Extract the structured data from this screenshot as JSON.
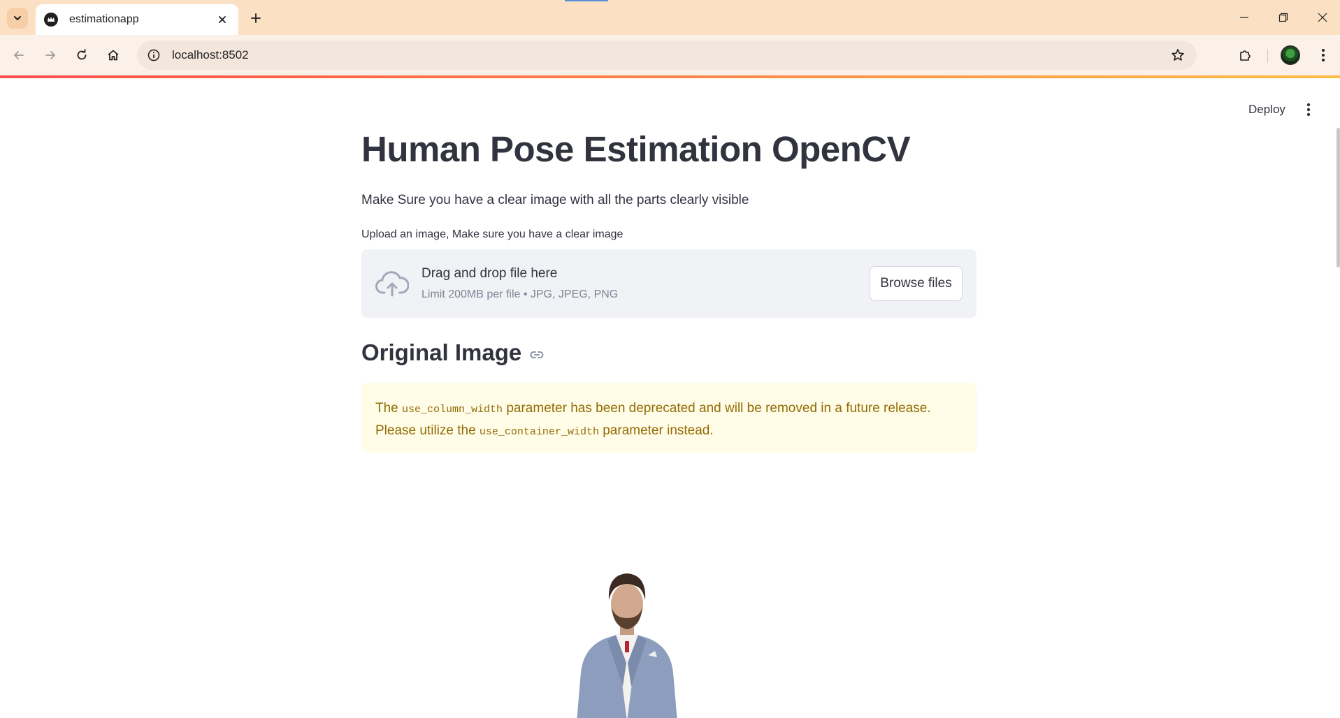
{
  "browser": {
    "tab_title": "estimationapp",
    "url": "localhost:8502"
  },
  "app": {
    "deploy_label": "Deploy",
    "title": "Human Pose Estimation OpenCV",
    "subtitle": "Make Sure you have a clear image with all the parts clearly visible",
    "uploader": {
      "label": "Upload an image, Make sure you have a clear image",
      "drag_text": "Drag and drop file here",
      "limit_text": "Limit 200MB per file • JPG, JPEG, PNG",
      "browse_label": "Browse files"
    },
    "section_heading": "Original Image",
    "warning": {
      "part1": "The ",
      "code1": "use_column_width",
      "part2": " parameter has been deprecated and will be removed in a future release. Please utilize the ",
      "code2": "use_container_width",
      "part3": " parameter instead."
    }
  },
  "colors": {
    "tabbar_bg": "#fce0c4",
    "toolbar_bg": "#fcf1e9",
    "text_primary": "#31333f",
    "dropzone_bg": "#f0f2f6",
    "warning_bg": "#fffce7",
    "warning_text": "#926c05"
  },
  "icons": {
    "tab_favicon": "streamlit-crown-icon",
    "upload": "cloud-upload-icon",
    "anchor": "link-icon"
  }
}
